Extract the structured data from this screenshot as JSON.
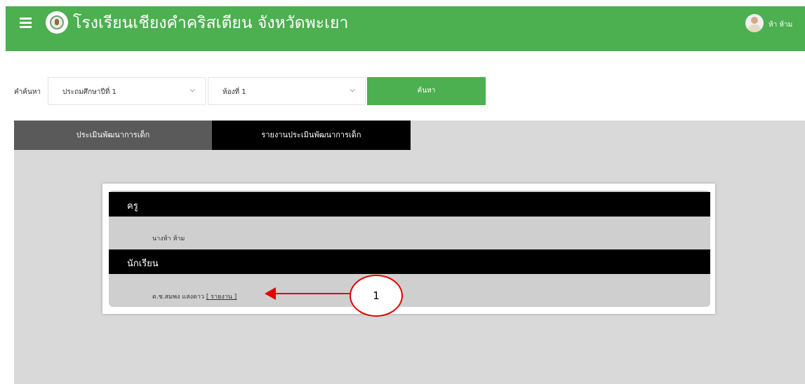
{
  "header": {
    "site_title": "โรงเรียนเชียงคำคริสเตียน จังหวัดพะเยา",
    "user_name": "ห้า ห้าม",
    "menu_icon": "hamburger-icon",
    "bg_color": "#4caf50"
  },
  "search": {
    "label": "คำค้นหา",
    "grade_value": "ประถมศึกษาปีที่ 1",
    "room_value": "ห้องที่ 1",
    "button_label": "ค้นหา"
  },
  "tabs": [
    {
      "label": "ประเมินพัฒนาการเด็ก"
    },
    {
      "label": "รายงานประเมินพัฒนาการเด็ก"
    }
  ],
  "teacher_section": {
    "title": "ครู",
    "name": "นางห้า ห้าม"
  },
  "student_section": {
    "title": "นักเรียน",
    "name": "ด.ช.สมพง แสงดาว",
    "report_link": "[ รายงาน ]"
  },
  "annotation": {
    "number": "1",
    "color": "#e60000"
  }
}
